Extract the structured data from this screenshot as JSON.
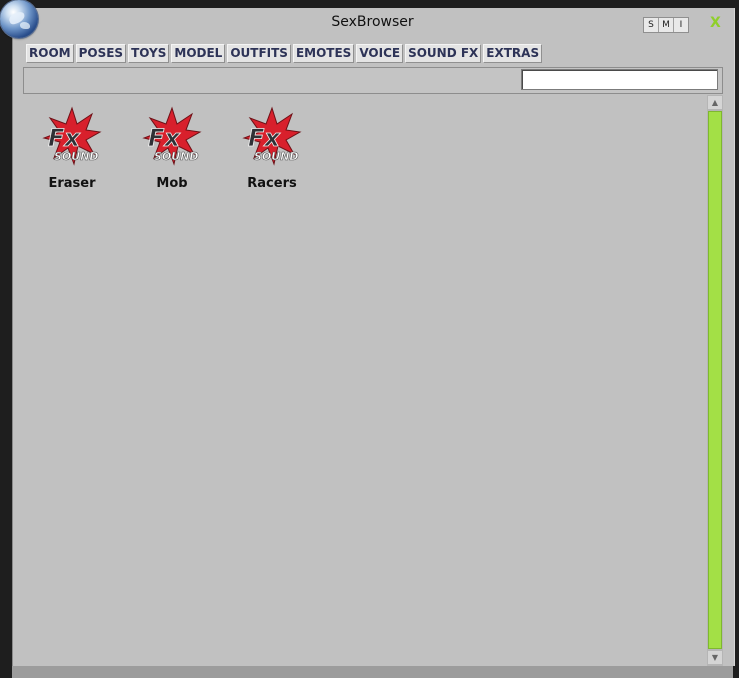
{
  "app": {
    "title": "SexBrowser"
  },
  "window_buttons": {
    "s": "S",
    "m": "M",
    "i": "I",
    "close": "X"
  },
  "tabs": [
    {
      "label": "ROOM"
    },
    {
      "label": "POSES"
    },
    {
      "label": "TOYS"
    },
    {
      "label": "MODEL"
    },
    {
      "label": "OUTFITS"
    },
    {
      "label": "EMOTES"
    },
    {
      "label": "VOICE"
    },
    {
      "label": "SOUND FX"
    },
    {
      "label": "EXTRAS"
    }
  ],
  "search": {
    "value": ""
  },
  "items": [
    {
      "label": "Eraser",
      "icon": "fx-sound-icon"
    },
    {
      "label": "Mob",
      "icon": "fx-sound-icon"
    },
    {
      "label": "Racers",
      "icon": "fx-sound-icon"
    }
  ],
  "icon_text": {
    "fx": "Fx",
    "sound": "SOUND"
  },
  "colors": {
    "accent_green": "#a3e046",
    "tab_text": "#2d3357",
    "fx_red": "#d8202c"
  }
}
